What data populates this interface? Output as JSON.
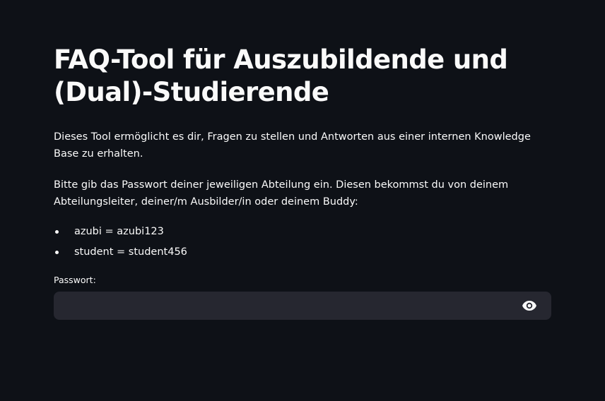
{
  "page": {
    "title": "FAQ-Tool für Auszubildende und (Dual)-Studierende",
    "intro": "Dieses Tool ermöglicht es dir, Fragen zu stellen und Antworten aus einer internen Knowledge Base zu erhalten.",
    "instructions": "Bitte gib das Passwort deiner jeweiligen Abteilung ein. Diesen bekommst du von deinem Abteilungsleiter, deiner/m Ausbilder/in oder deinem Buddy:",
    "credentials": [
      "azubi = azubi123",
      "student = student456"
    ]
  },
  "password_field": {
    "label": "Passwort:",
    "value": "",
    "toggle_icon": "eye-icon"
  },
  "colors": {
    "background": "#0e1117",
    "input_background": "#262730",
    "text": "#fafafa"
  }
}
